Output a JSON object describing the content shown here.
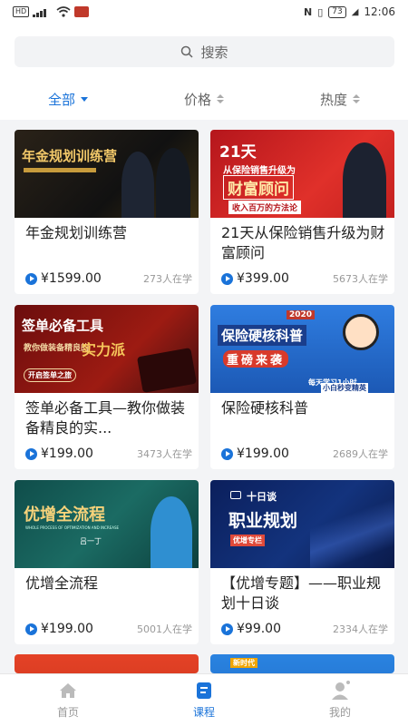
{
  "status_bar": {
    "left_badge": "HD",
    "time": "12:06",
    "battery": "73",
    "icons": [
      "signal-icon",
      "wifi-icon",
      "notification-icon",
      "nfc-icon",
      "vibrate-icon",
      "battery-icon",
      "leaf-icon"
    ]
  },
  "search": {
    "placeholder": "搜索",
    "icon": "search-icon"
  },
  "filters": [
    {
      "label": "全部",
      "active": true,
      "icon": "caret-down-icon"
    },
    {
      "label": "价格",
      "active": false,
      "icon": "sort-icon"
    },
    {
      "label": "热度",
      "active": false,
      "icon": "sort-icon"
    }
  ],
  "colors": {
    "accent": "#1a73d9",
    "text_primary": "#222222",
    "text_secondary": "#999999",
    "background": "#f3f4f6"
  },
  "courses": [
    {
      "title": "年金规划训练营",
      "price": "¥1599.00",
      "learners": "273人在学",
      "thumb_text": "年金规划训练营"
    },
    {
      "title": "21天从保险销售升级为财富顾问",
      "price": "¥399.00",
      "learners": "5673人在学",
      "thumb_text": "21天",
      "thumb_sub": "从保险销售升级为",
      "thumb_main": "财富顾问",
      "thumb_tag": "收入百万的方法论"
    },
    {
      "title": "签单必备工具—教你做装备精良的实...",
      "price": "¥199.00",
      "learners": "3473人在学",
      "thumb_text": "签单必备工具",
      "thumb_sub": "教你做装备精良的",
      "thumb_main": "实力派",
      "thumb_tag": "开启签单之旅"
    },
    {
      "title": "保险硬核科普",
      "price": "¥199.00",
      "learners": "2689人在学",
      "thumb_text": "保险硬核科普",
      "thumb_sub": "重磅来袭",
      "thumb_tag": "每天学习1小时",
      "thumb_tag2": "小白秒变精英",
      "thumb_year": "2020"
    },
    {
      "title": "优增全流程",
      "price": "¥199.00",
      "learners": "5001人在学",
      "thumb_text": "优增全流程",
      "thumb_sub": "WHOLE PROCESS OF OPTIMIZATION AND INCREASE",
      "thumb_tag": "吕一丁"
    },
    {
      "title": "【优增专题】——职业规划十日谈",
      "price": "¥99.00",
      "learners": "2334人在学",
      "thumb_text": "职业规划",
      "thumb_sub": "十日谈",
      "thumb_tag": "优增专栏"
    }
  ],
  "partial_cards": [
    {
      "tag": ""
    },
    {
      "tag": "新时代"
    }
  ],
  "bottom_nav": [
    {
      "label": "首页",
      "active": false,
      "icon": "home-icon"
    },
    {
      "label": "课程",
      "active": true,
      "icon": "course-icon"
    },
    {
      "label": "我的",
      "active": false,
      "icon": "profile-icon"
    }
  ]
}
